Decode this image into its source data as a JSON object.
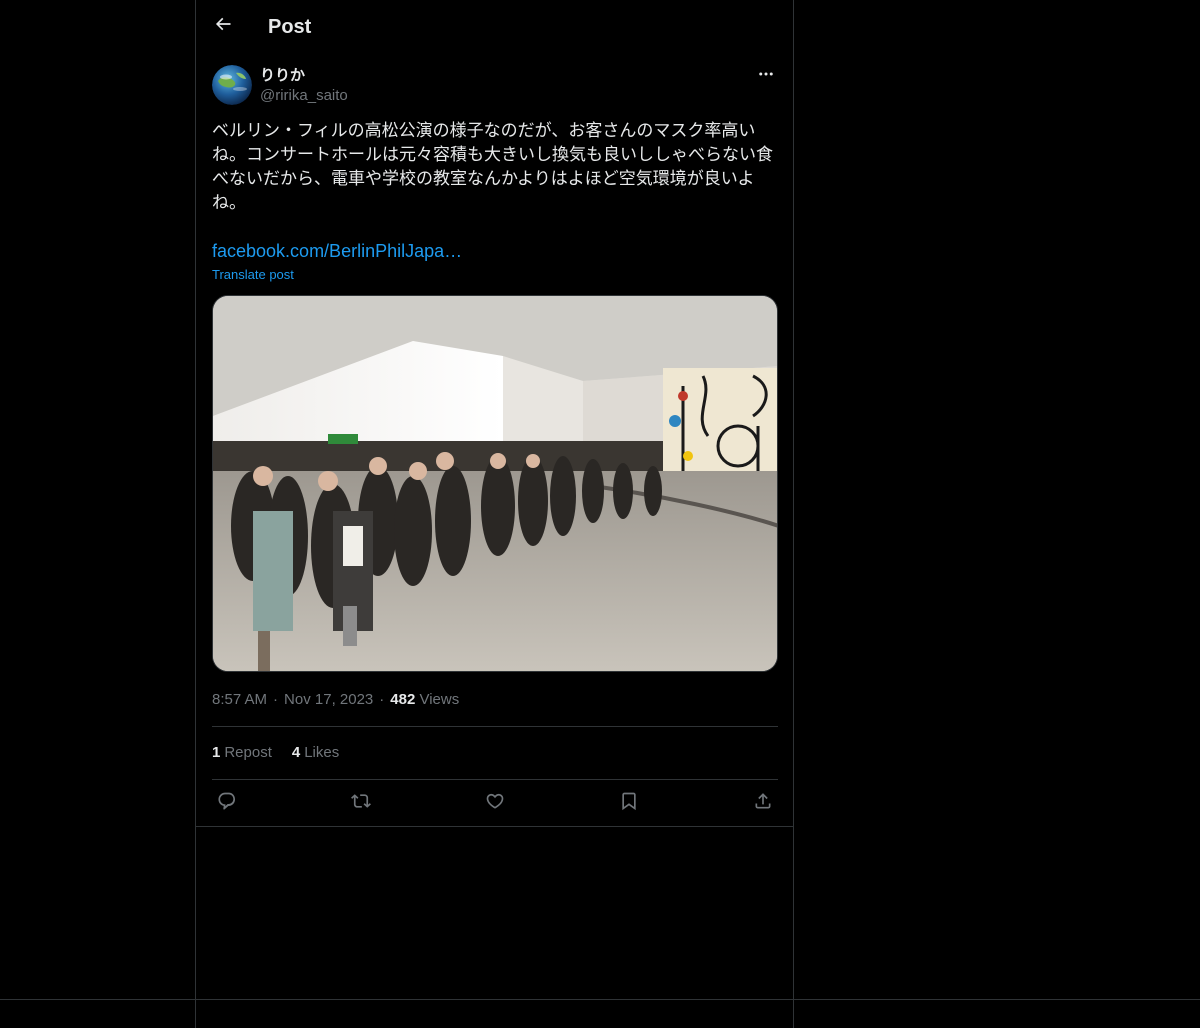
{
  "header": {
    "title": "Post",
    "back_icon": "arrow-left-icon"
  },
  "post": {
    "author": {
      "display_name": "りりか",
      "handle": "@ririka_saito",
      "avatar_icon": "globe-avatar"
    },
    "text": "ベルリン・フィルの高松公演の様子なのだが、お客さんのマスク率高いね。コンサートホールは元々容積も大きいし換気も良いししゃべらない食べないだから、電車や学校の教室なんかよりはよほど空気環境が良いよね。",
    "link": "facebook.com/BerlinPhilJapa…",
    "translate_label": "Translate post",
    "media_icon": "photo",
    "time": "8:57 AM",
    "date": "Nov 17, 2023",
    "views_count": "482",
    "views_label": "Views",
    "reposts_count": "1",
    "reposts_label": "Repost",
    "likes_count": "4",
    "likes_label": "Likes"
  },
  "actions": {
    "reply_icon": "reply-icon",
    "repost_icon": "repost-icon",
    "like_icon": "like-icon",
    "bookmark_icon": "bookmark-icon",
    "share_icon": "share-icon"
  },
  "colors": {
    "background": "#000000",
    "text": "#e7e9ea",
    "secondary": "#71767b",
    "accent": "#1d9bf0",
    "border": "#2f3336"
  }
}
